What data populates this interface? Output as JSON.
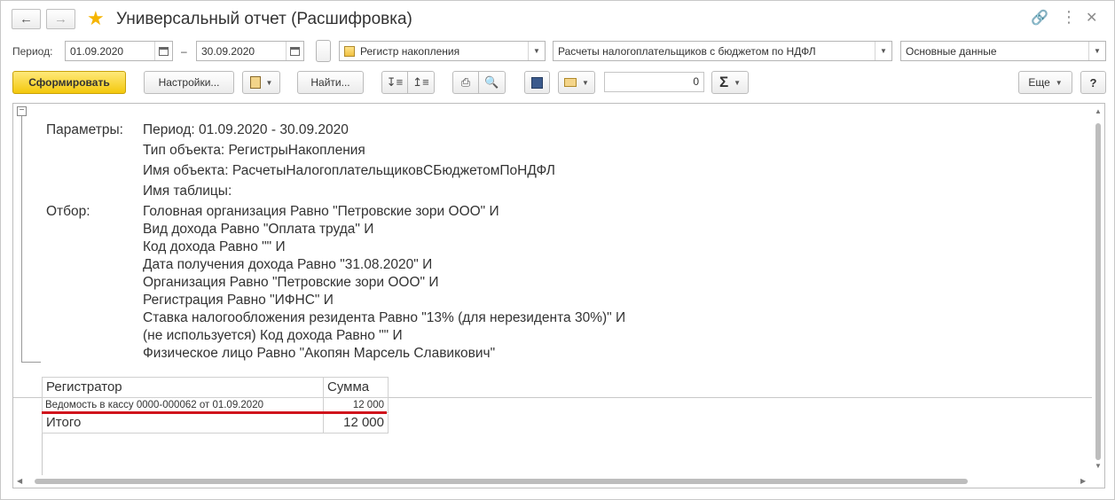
{
  "window": {
    "title": "Универсальный отчет (Расшифровка)"
  },
  "filters": {
    "period_label": "Период:",
    "date_from": "01.09.2020",
    "dash": "–",
    "date_to": "30.09.2020",
    "object_type": "Регистр накопления",
    "object_name": "Расчеты налогоплательщиков с бюджетом по НДФЛ",
    "table_name": "Основные данные"
  },
  "toolbar": {
    "generate": "Сформировать",
    "settings": "Настройки...",
    "find": "Найти...",
    "sum_value": "0",
    "sigma": "Σ",
    "more": "Еще",
    "help": "?"
  },
  "report": {
    "params_label": "Параметры:",
    "params": [
      "Период: 01.09.2020 - 30.09.2020",
      "Тип объекта: РегистрыНакопления",
      "Имя объекта: РасчетыНалогоплательщиковСБюджетомПоНДФЛ",
      "Имя таблицы:"
    ],
    "filter_label": "Отбор:",
    "filters": [
      "Головная организация Равно \"Петровские зори ООО\" И",
      "Вид дохода Равно \"Оплата труда\" И",
      "Код дохода Равно \"\" И",
      "Дата получения дохода Равно \"31.08.2020\" И",
      "Организация Равно \"Петровские зори ООО\" И",
      "Регистрация Равно \"ИФНС\" И",
      "Ставка налогообложения резидента Равно \"13% (для нерезидента 30%)\" И",
      "(не используется) Код дохода Равно \"\" И",
      "Физическое лицо Равно \"Акопян Марсель Славикович\""
    ],
    "table": {
      "headers": [
        "Регистратор",
        "Сумма"
      ],
      "rows": [
        {
          "registrar": "Ведомость в кассу 0000-000062 от 01.09.2020",
          "sum": "12 000"
        }
      ],
      "total_label": "Итого",
      "total_sum": "12 000"
    }
  },
  "colors": {
    "primary_button": "#f3c80d",
    "highlight_underline": "#d0141c",
    "star": "#f5b400"
  }
}
